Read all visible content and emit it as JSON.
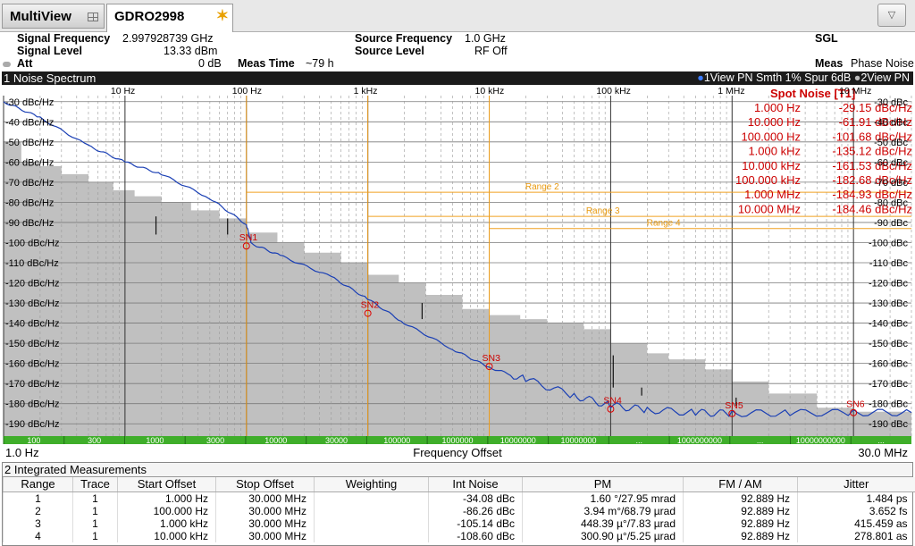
{
  "tabs": {
    "multiview": "MultiView",
    "measurement": "GDRO2998"
  },
  "info": {
    "signal_frequency_label": "Signal Frequency",
    "signal_frequency_value": "2.997928739 GHz",
    "signal_level_label": "Signal Level",
    "signal_level_value": "13.33 dBm",
    "att_label": "Att",
    "att_value": "0 dB",
    "meas_time_label": "Meas Time",
    "meas_time_value": "~79 h",
    "source_frequency_label": "Source Frequency",
    "source_frequency_value": "1.0 GHz",
    "source_level_label": "Source Level",
    "source_level_value": "RF Off",
    "sgl": "SGL",
    "meas_label": "Meas",
    "meas_value": "Phase Noise"
  },
  "window1": {
    "title": "1 Noise Spectrum",
    "trace_info_1": "1View PN Smth 1% Spur 6dB",
    "trace_info_2": "2View PN",
    "x_start": "1.0 Hz",
    "x_stop": "30.0 MHz",
    "x_axis_label": "Frequency Offset"
  },
  "chart_data": {
    "type": "line",
    "x_scale": "log",
    "xlim": [
      1,
      30000000
    ],
    "ylim": [
      -197,
      -27
    ],
    "top_tick_labels": [
      {
        "f": 10,
        "label": "10 Hz"
      },
      {
        "f": 100,
        "label": "100 Hz"
      },
      {
        "f": 1000,
        "label": "1 kHz"
      },
      {
        "f": 10000,
        "label": "10 kHz"
      },
      {
        "f": 100000,
        "label": "100 kHz"
      },
      {
        "f": 1000000,
        "label": "1 MHz"
      },
      {
        "f": 10000000,
        "label": "10 MHz"
      }
    ],
    "y_ticks": [
      -30,
      -40,
      -50,
      -60,
      -70,
      -80,
      -90,
      -100,
      -110,
      -120,
      -130,
      -140,
      -150,
      -160,
      -170,
      -180,
      -190
    ],
    "y_tick_unit": "dBc/Hz",
    "right_tick_unit": "dBc",
    "green_bar_labels": [
      "100",
      "300",
      "1000",
      "3000",
      "10000",
      "30000",
      "100000",
      "1000000",
      "10000000",
      "10000000",
      "...",
      "1000000000",
      "...",
      "10000000000",
      "..."
    ],
    "series": [
      {
        "name": "1View PN",
        "color": "#1a3fb4",
        "points": [
          [
            1,
            -30
          ],
          [
            2,
            -38
          ],
          [
            5,
            -52
          ],
          [
            10,
            -60
          ],
          [
            20,
            -66
          ],
          [
            50,
            -78
          ],
          [
            100,
            -91
          ],
          [
            110,
            -100.5
          ],
          [
            200,
            -107
          ],
          [
            500,
            -117
          ],
          [
            1000,
            -128
          ],
          [
            2000,
            -140
          ],
          [
            5000,
            -153
          ],
          [
            10000,
            -162
          ],
          [
            20000,
            -168
          ],
          [
            50000,
            -176
          ],
          [
            100000,
            -181
          ],
          [
            200000,
            -183
          ],
          [
            500000,
            -184.5
          ],
          [
            1000000,
            -184.8
          ],
          [
            3000000,
            -184.6
          ],
          [
            10000000,
            -184.46
          ],
          [
            30000000,
            -184.4
          ]
        ]
      }
    ],
    "floor_steps": [
      [
        1,
        -50
      ],
      [
        1.4,
        -60
      ],
      [
        2,
        -62
      ],
      [
        3,
        -66
      ],
      [
        5,
        -70
      ],
      [
        8,
        -74
      ],
      [
        12,
        -77
      ],
      [
        20,
        -80
      ],
      [
        35,
        -84
      ],
      [
        60,
        -88
      ],
      [
        100,
        -95
      ],
      [
        180,
        -100
      ],
      [
        300,
        -105
      ],
      [
        600,
        -110
      ],
      [
        1000,
        -116
      ],
      [
        1800,
        -120
      ],
      [
        3000,
        -126
      ],
      [
        6000,
        -133
      ],
      [
        10000,
        -136
      ],
      [
        18000,
        -138
      ],
      [
        30000,
        -140
      ],
      [
        60000,
        -143
      ],
      [
        100000,
        -150
      ],
      [
        200000,
        -155
      ],
      [
        300000,
        -158
      ],
      [
        600000,
        -163
      ],
      [
        1000000,
        -169
      ],
      [
        2000000,
        -175
      ],
      [
        5000000,
        -182
      ],
      [
        10000000,
        -184
      ],
      [
        30000000,
        -186
      ]
    ],
    "spurs": [
      {
        "f": 18,
        "low": -96,
        "high": -87
      },
      {
        "f": 70,
        "low": -96,
        "high": -88
      },
      {
        "f": 2800,
        "low": -138,
        "high": -130
      },
      {
        "f": 105000,
        "low": -172,
        "high": -156
      },
      {
        "f": 180000,
        "low": -176,
        "high": -172
      },
      {
        "f": 1080000,
        "low": -181,
        "high": -177
      }
    ],
    "markers": [
      {
        "label": "SN1",
        "f": 100,
        "y": -101.68
      },
      {
        "label": "SN2",
        "f": 1000,
        "y": -135.12
      },
      {
        "label": "SN3",
        "f": 10000,
        "y": -161.53
      },
      {
        "label": "SN4",
        "f": 100000,
        "y": -182.68
      },
      {
        "label": "SN5",
        "f": 1000000,
        "y": -184.93
      },
      {
        "label": "SN6",
        "f": 10000000,
        "y": -184.46
      }
    ],
    "ranges": [
      {
        "label": "Range 2",
        "start": 100,
        "stop": 30000000,
        "level": -75
      },
      {
        "label": "Range 3",
        "start": 1000,
        "stop": 30000000,
        "level": -87
      },
      {
        "label": "Range 4",
        "start": 10000,
        "stop": 30000000,
        "level": -93
      }
    ],
    "spot_noise": {
      "title": "Spot Noise [T1]",
      "rows": [
        {
          "offset": "1.000 Hz",
          "value": "-29.15 dBc/Hz"
        },
        {
          "offset": "10.000 Hz",
          "value": "-61.91 dBc/Hz"
        },
        {
          "offset": "100.000 Hz",
          "value": "-101.68 dBc/Hz"
        },
        {
          "offset": "1.000 kHz",
          "value": "-135.12 dBc/Hz"
        },
        {
          "offset": "10.000 kHz",
          "value": "-161.53 dBc/Hz"
        },
        {
          "offset": "100.000 kHz",
          "value": "-182.68 dBc/Hz"
        },
        {
          "offset": "1.000 MHz",
          "value": "-184.93 dBc/Hz"
        },
        {
          "offset": "10.000 MHz",
          "value": "-184.46 dBc/Hz"
        }
      ]
    }
  },
  "window2": {
    "title": "2 Integrated Measurements",
    "headers": [
      "Range",
      "Trace",
      "Start Offset",
      "Stop Offset",
      "Weighting",
      "Int Noise",
      "PM",
      "FM / AM",
      "Jitter"
    ],
    "rows": [
      [
        "1",
        "1",
        "1.000 Hz",
        "30.000 MHz",
        "",
        "-34.08 dBc",
        "1.60 °/27.95 mrad",
        "92.889 Hz",
        "1.484 ps"
      ],
      [
        "2",
        "1",
        "100.000 Hz",
        "30.000 MHz",
        "",
        "-86.26 dBc",
        "3.94 m°/68.79 µrad",
        "92.889 Hz",
        "3.652 fs"
      ],
      [
        "3",
        "1",
        "1.000 kHz",
        "30.000 MHz",
        "",
        "-105.14 dBc",
        "448.39 µ°/7.83 µrad",
        "92.889 Hz",
        "415.459 as"
      ],
      [
        "4",
        "1",
        "10.000 kHz",
        "30.000 MHz",
        "",
        "-108.60 dBc",
        "300.90 µ°/5.25 µrad",
        "92.889 Hz",
        "278.801 as"
      ]
    ]
  }
}
